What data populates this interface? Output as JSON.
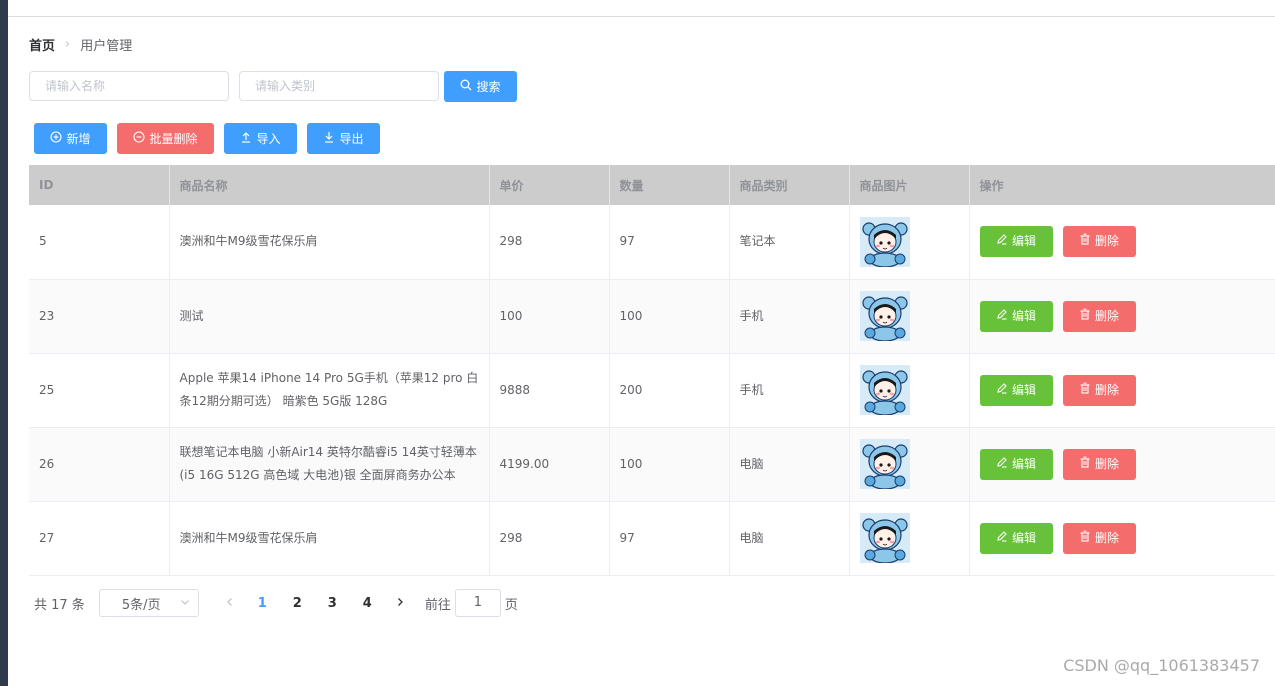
{
  "breadcrumb": {
    "home": "首页",
    "current": "用户管理"
  },
  "search": {
    "name_placeholder": "请输入名称",
    "category_placeholder": "请输入类别",
    "search_label": "搜索"
  },
  "toolbar": {
    "add_label": "新增",
    "batch_delete_label": "批量删除",
    "import_label": "导入",
    "export_label": "导出"
  },
  "table": {
    "headers": [
      "ID",
      "商品名称",
      "单价",
      "数量",
      "商品类别",
      "商品图片",
      "操作"
    ],
    "rows": [
      {
        "id": "5",
        "name": "澳洲和牛M9级雪花保乐肩",
        "price": "298",
        "qty": "97",
        "category": "笔记本"
      },
      {
        "id": "23",
        "name": "测试",
        "price": "100",
        "qty": "100",
        "category": "手机"
      },
      {
        "id": "25",
        "name": "Apple 苹果14 iPhone 14 Pro 5G手机（苹果12 pro 白条12期分期可选） 暗紫色 5G版 128G",
        "price": "9888",
        "qty": "200",
        "category": "手机"
      },
      {
        "id": "26",
        "name": "联想笔记本电脑 小新Air14 英特尔酷睿i5 14英寸轻薄本(i5 16G 512G 高色域 大电池)银 全面屏商务办公本",
        "price": "4199.00",
        "qty": "100",
        "category": "电脑"
      },
      {
        "id": "27",
        "name": "澳洲和牛M9级雪花保乐肩",
        "price": "298",
        "qty": "97",
        "category": "电脑"
      }
    ],
    "edit_label": "编辑",
    "delete_label": "删除"
  },
  "pagination": {
    "total_label": "共 17 条",
    "page_size": "5条/页",
    "pages": [
      "1",
      "2",
      "3",
      "4"
    ],
    "current_page": "1",
    "goto_prefix": "前往",
    "goto_value": "1",
    "goto_suffix": "页"
  },
  "watermark": "CSDN @qq_1061383457",
  "colors": {
    "primary": "#409eff",
    "danger": "#f56c6c",
    "success": "#67c23a",
    "header_bg": "#cccccc"
  },
  "icons": {
    "search": "search-icon",
    "add": "plus-circle-icon",
    "batch_delete": "minus-circle-icon",
    "import": "upload-icon",
    "export": "download-icon",
    "edit": "pencil-icon",
    "delete": "trash-icon"
  }
}
